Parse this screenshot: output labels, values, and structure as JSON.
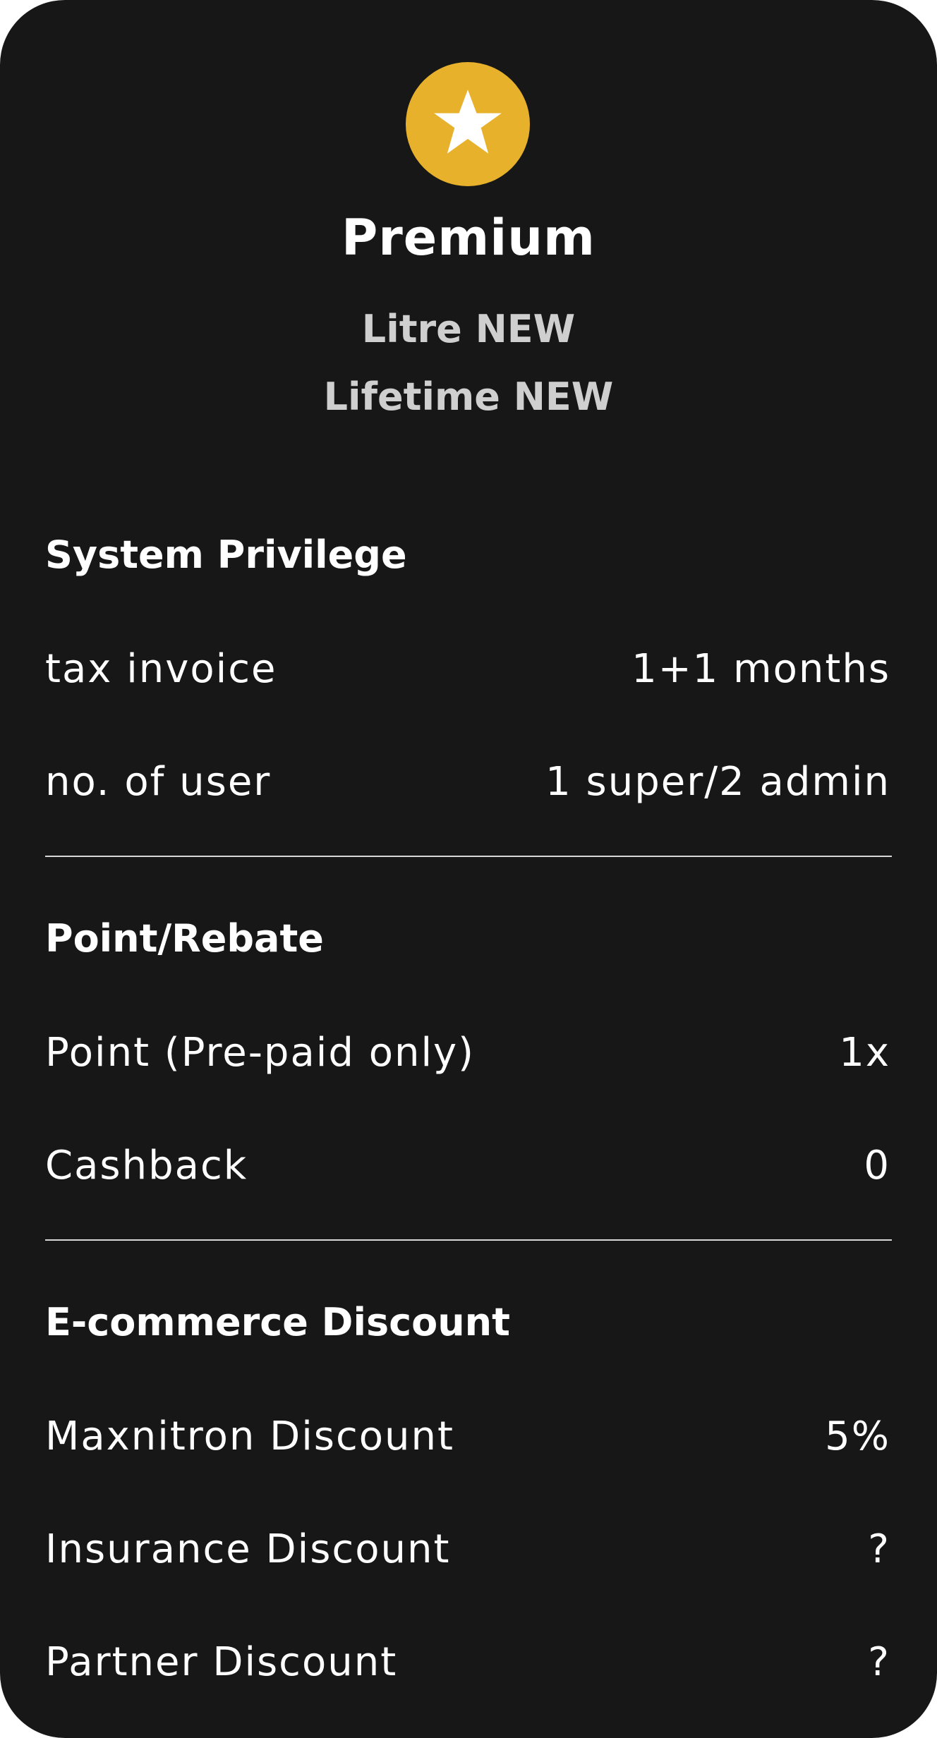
{
  "tier": {
    "title": "Premium",
    "subtitle_1": "Litre NEW",
    "subtitle_2": "Lifetime NEW",
    "icon": "star-icon",
    "badge_color": "#e8b12b"
  },
  "sections": [
    {
      "title": "System Privilege",
      "rows": [
        {
          "label": "tax invoice",
          "value": "1+1 months"
        },
        {
          "label": "no. of user",
          "value": "1 super/2 admin"
        }
      ]
    },
    {
      "title": "Point/Rebate",
      "rows": [
        {
          "label": "Point (Pre-paid only)",
          "value": "1x"
        },
        {
          "label": "Cashback",
          "value": "0"
        }
      ]
    },
    {
      "title": "E-commerce Discount",
      "rows": [
        {
          "label": "Maxnitron Discount",
          "value": "5%"
        },
        {
          "label": "Insurance Discount",
          "value": "?"
        },
        {
          "label": "Partner Discount",
          "value": "?"
        }
      ]
    }
  ],
  "colors": {
    "background": "#171717",
    "text": "#ffffff",
    "subtitle": "#cfcfcf",
    "accent": "#e8b12b"
  }
}
